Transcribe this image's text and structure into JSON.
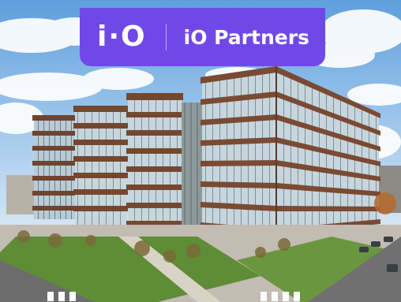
{
  "banner": {
    "logo_text": "i·O",
    "partner_name": "iO Partners",
    "background_color": "#7148e8",
    "text_color": "#ffffff"
  },
  "photo": {
    "subject": "office-building-photo",
    "sky_color": "#8cbbe6",
    "facade_band_color": "#7a4a33",
    "glass_color": "#c9d9e0",
    "lawn_color": "#5f8c36"
  }
}
